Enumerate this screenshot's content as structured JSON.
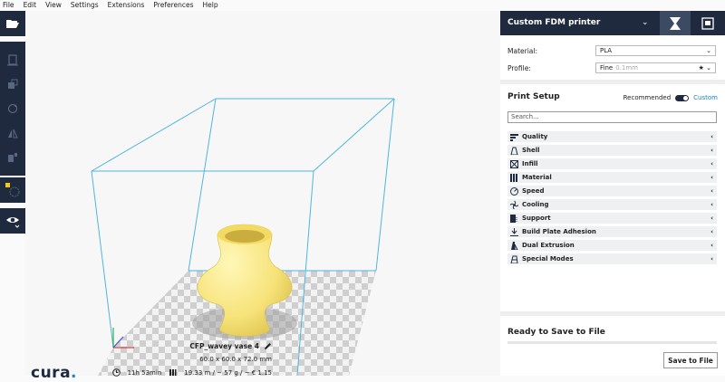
{
  "menu": [
    "File",
    "Edit",
    "View",
    "Settings",
    "Extensions",
    "Preferences",
    "Help"
  ],
  "toolbar": {
    "icons": [
      "open-file-icon",
      "translate-icon",
      "scale-icon",
      "rotate-icon",
      "mirror-icon",
      "per-model-settings-icon",
      "support-blocker-icon",
      "view-mode-icon"
    ]
  },
  "logo": {
    "text": "cura",
    "dot": "."
  },
  "job": {
    "name": "CFP_wavey vase 4",
    "dimensions": "60.0 x 60.0 x 72.0 mm",
    "time": "11h 53min",
    "material": "19.33 m / ~ 57 g / ~ € 1.15"
  },
  "panel": {
    "printer_name": "Custom FDM printer",
    "material_label": "Material:",
    "material_value": "PLA",
    "profile_label": "Profile:",
    "profile_value": "Fine",
    "profile_hint": "0.1mm",
    "setup_title": "Print Setup",
    "mode_recommended": "Recommended",
    "mode_custom": "Custom",
    "search_placeholder": "Search...",
    "categories": [
      {
        "label": "Quality",
        "icon": "quality-icon"
      },
      {
        "label": "Shell",
        "icon": "shell-icon"
      },
      {
        "label": "Infill",
        "icon": "infill-icon"
      },
      {
        "label": "Material",
        "icon": "material-icon"
      },
      {
        "label": "Speed",
        "icon": "speed-icon"
      },
      {
        "label": "Cooling",
        "icon": "cooling-icon"
      },
      {
        "label": "Support",
        "icon": "support-icon"
      },
      {
        "label": "Build Plate Adhesion",
        "icon": "adhesion-icon"
      },
      {
        "label": "Dual Extrusion",
        "icon": "dual-extrusion-icon"
      },
      {
        "label": "Special Modes",
        "icon": "special-modes-icon"
      }
    ],
    "ready_text": "Ready to Save to File",
    "progress": 0,
    "save_label": "Save to File"
  },
  "colors": {
    "sidebar_dark": "#1f2a3e",
    "accent": "#1a85c8",
    "model": "#f7e37a",
    "build_volume": "#4fb6e0"
  }
}
